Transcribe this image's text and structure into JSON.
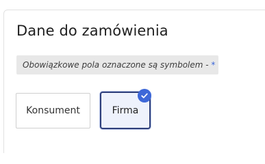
{
  "heading": "Dane do zamówienia",
  "notice": {
    "text": "Obowiązkowe pola oznaczone są symbolem - ",
    "symbol": "*"
  },
  "customer_type": {
    "options": [
      "Konsument",
      "Firma"
    ],
    "selected": "Firma"
  },
  "colors": {
    "accent": "#3e68d8",
    "selected_border": "#2e3f7a",
    "selected_bg": "#eef2fc"
  },
  "icons": {
    "selected_marker": "check-circle-icon"
  }
}
